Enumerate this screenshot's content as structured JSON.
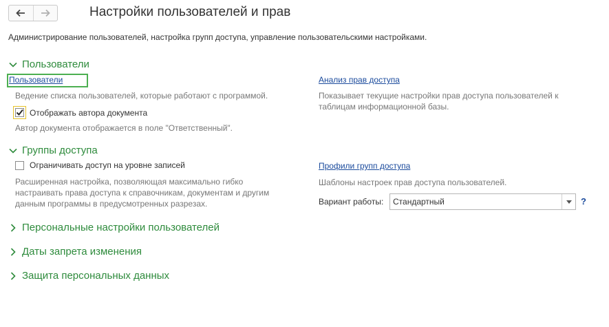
{
  "header": {
    "back_icon": "arrow-left-icon",
    "forward_icon": "arrow-right-icon",
    "title": "Настройки пользователей и прав",
    "description": "Администрирование пользователей, настройка групп доступа, управление пользовательскими настройками."
  },
  "sections": {
    "users": {
      "title": "Пользователи",
      "users_link": "Пользователи",
      "users_hint": "Ведение списка пользователей, которые работают с программой.",
      "show_author_label": "Отображать автора документа",
      "show_author_checked": true,
      "show_author_hint": "Автор документа отображается в поле \"Ответственный\".",
      "rights_analysis_link": "Анализ прав доступа",
      "rights_analysis_hint_1": "Показывает текущие настройки прав доступа пользователей к",
      "rights_analysis_hint_2": "таблицам информационной базы."
    },
    "access_groups": {
      "title": "Группы доступа",
      "restrict_label": "Ограничивать доступ на уровне записей",
      "restrict_checked": false,
      "restrict_hint_1": "Расширенная настройка, позволяющая максимально гибко",
      "restrict_hint_2": "настраивать права доступа к справочникам, документам и другим",
      "restrict_hint_3": "данным программы в предусмотренных разрезах.",
      "profiles_link": "Профили групп доступа",
      "profiles_hint": "Шаблоны настроек прав доступа пользователей.",
      "mode_label": "Вариант работы:",
      "mode_value": "Стандартный",
      "help": "?"
    },
    "personal_settings": {
      "title": "Персональные настройки пользователей"
    },
    "change_prohibition": {
      "title": "Даты запрета изменения"
    },
    "personal_data": {
      "title": "Защита персональных данных"
    }
  },
  "colors": {
    "section": "#2e8b3c",
    "link": "#1a4a9c",
    "hint": "#777777",
    "focus": "#4caf50"
  }
}
